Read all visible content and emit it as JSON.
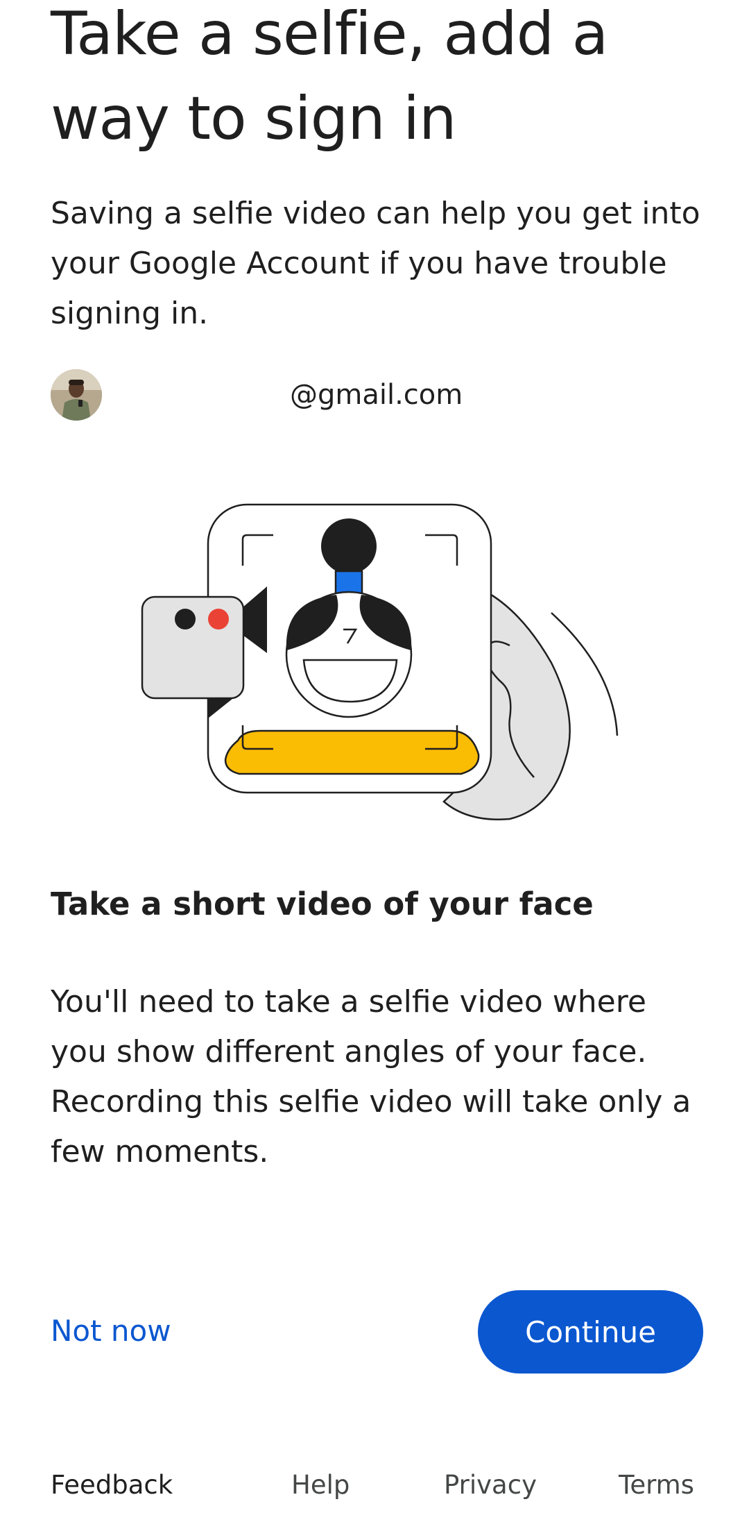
{
  "header": {
    "title_line1": "Take a selfie, add a",
    "title_line2": "way to sign in"
  },
  "intro": {
    "text": "Saving a selfie video can help you get into your Google Account if you have trouble signing in."
  },
  "account": {
    "email": "@gmail.com",
    "avatar_icon": "user-avatar-photo"
  },
  "illustration": {
    "icon": "selfie-video-illustration",
    "colors": {
      "outline": "#1f1f1f",
      "yellow": "#fbbc04",
      "blue": "#1a73e8",
      "red": "#ea4335",
      "gray": "#e3e3e3"
    }
  },
  "section": {
    "heading": "Take a short video of your face",
    "body": "You'll need to take a selfie video where you show different angles of your face. Recording this selfie video will take only a few moments."
  },
  "actions": {
    "secondary_label": "Not now",
    "primary_label": "Continue",
    "accent_color": "#0b57d0"
  },
  "footer": {
    "feedback": "Feedback",
    "help": "Help",
    "privacy": "Privacy",
    "terms": "Terms"
  }
}
